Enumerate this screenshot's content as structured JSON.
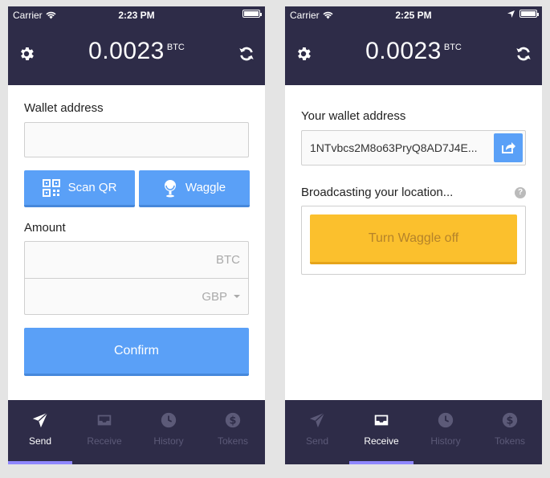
{
  "colors": {
    "header_bg": "#2e2c48",
    "accent_blue": "#5aa0f7",
    "accent_yellow": "#fbc02d",
    "active_tab_indicator": "#8f87ff"
  },
  "left": {
    "status": {
      "carrier": "Carrier",
      "time": "2:23 PM"
    },
    "header": {
      "balance": "0.0023",
      "unit": "BTC"
    },
    "wallet_label": "Wallet address",
    "wallet_value": "",
    "scan_qr_label": "Scan QR",
    "waggle_label": "Waggle",
    "amount_label": "Amount",
    "amount_btc_unit": "BTC",
    "amount_gbp_unit": "GBP",
    "confirm_label": "Confirm",
    "tabs": [
      {
        "label": "Send",
        "icon": "send-icon",
        "active": true
      },
      {
        "label": "Receive",
        "icon": "receive-icon",
        "active": false
      },
      {
        "label": "History",
        "icon": "history-icon",
        "active": false
      },
      {
        "label": "Tokens",
        "icon": "tokens-icon",
        "active": false
      }
    ]
  },
  "right": {
    "status": {
      "carrier": "Carrier",
      "time": "2:25 PM"
    },
    "header": {
      "balance": "0.0023",
      "unit": "BTC"
    },
    "your_wallet_label": "Your wallet address",
    "wallet_address": "1NTvbcs2M8o63PryQ8AD7J4E...",
    "broadcasting_label": "Broadcasting your location...",
    "help_glyph": "?",
    "turn_waggle_off_label": "Turn Waggle off",
    "tabs": [
      {
        "label": "Send",
        "icon": "send-icon",
        "active": false
      },
      {
        "label": "Receive",
        "icon": "receive-icon",
        "active": true
      },
      {
        "label": "History",
        "icon": "history-icon",
        "active": false
      },
      {
        "label": "Tokens",
        "icon": "tokens-icon",
        "active": false
      }
    ]
  }
}
